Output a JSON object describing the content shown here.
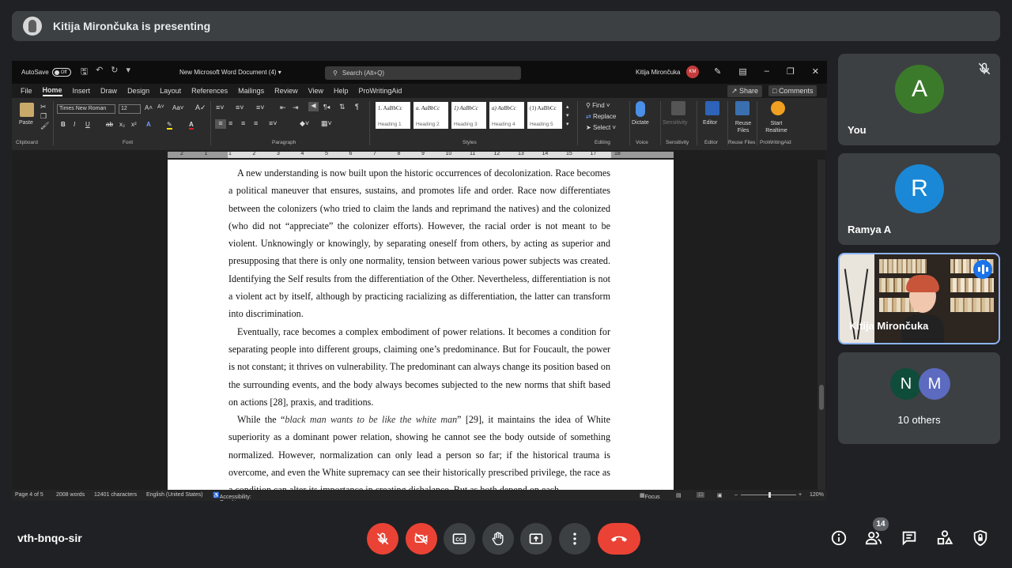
{
  "banner": {
    "text": "Kitija Mirončuka is presenting"
  },
  "word": {
    "autosave_label": "AutoSave",
    "autosave_state": "Off",
    "doc_title": "New Microsoft Word Document (4)",
    "search_placeholder": "Search (Alt+Q)",
    "user_name": "Kitija Mirončuka",
    "user_initials": "KM",
    "menu": [
      "File",
      "Home",
      "Insert",
      "Draw",
      "Design",
      "Layout",
      "References",
      "Mailings",
      "Review",
      "View",
      "Help",
      "ProWritingAid"
    ],
    "share_label": "Share",
    "comments_label": "Comments",
    "ribbon": {
      "paste": "Paste",
      "font_name": "Times New Roman",
      "font_size": "12",
      "styles": [
        {
          "preview": "1.  AaBbCc",
          "name": "Heading 1"
        },
        {
          "preview": "a.  AaBbCc",
          "name": "Heading 2"
        },
        {
          "preview": "1)  AaBbCc",
          "name": "Heading 3"
        },
        {
          "preview": "a)  AaBbCc",
          "name": "Heading 4"
        },
        {
          "preview": "(1)  AaBbCc",
          "name": "Heading 5"
        }
      ],
      "find": "Find",
      "replace": "Replace",
      "select": "Select",
      "dictate": "Dictate",
      "sensitivity": "Sensitivity",
      "editor": "Editor",
      "reuse_files": "Reuse Files",
      "start_realtime": "Start Realtime",
      "groups": [
        "Clipboard",
        "Font",
        "Paragraph",
        "Styles",
        "Editing",
        "Voice",
        "Sensitivity",
        "Editor",
        "Reuse Files",
        "ProWritingAid"
      ]
    },
    "ruler_numbers": [
      "2",
      "1",
      "1",
      "2",
      "3",
      "4",
      "5",
      "6",
      "7",
      "8",
      "9",
      "10",
      "11",
      "12",
      "13",
      "14",
      "15",
      "17",
      "18"
    ],
    "paragraphs": [
      "A new understanding is now built upon the historic occurrences of decolonization. Race becomes a political maneuver that ensures, sustains, and promotes life and order. Race now differentiates between the colonizers (who tried to claim the lands and reprimand the natives) and the colonized (who did not “appreciate” the colonizer efforts). However, the racial order is not meant to be violent. Unknowingly or knowingly, by separating oneself from others, by acting as superior and presupposing that there is only one normality, tension between various power subjects was created. Identifying the Self results from the differentiation of the Other. Nevertheless, differentiation is not a violent act by itself, although by practicing racializing as differentiation, the latter can transform into discrimination.",
      "Eventually, race becomes a complex embodiment of power relations. It becomes a condition for separating people into different groups, claiming one’s predominance. But for Foucault, the power is not constant; it thrives on vulnerability. The predominant can always change its position based on the surrounding events, and the body always becomes subjected to the new norms that shift based on actions [28], praxis, and traditions."
    ],
    "para3": {
      "before": "While the “",
      "italic": "black man wants to be like the white man",
      "after": "” [29], it maintains the idea of White superiority as a dominant power relation, showing he cannot see the body outside of something normalized. However, normalization can only lead a person so far; if the historical trauma is overcome, and even the White supremacy can see their historically prescribed privilege, the race as a condition can alter its importance in creating disbalance. But as both depend on each"
    },
    "status": {
      "page": "Page 4 of 5",
      "words": "2008 words",
      "chars": "12401 characters",
      "language": "English (United States)",
      "accessibility": "Accessibility: Good to go",
      "focus": "Focus",
      "zoom": "120%"
    }
  },
  "participants": [
    {
      "name": "You",
      "initial": "A",
      "color": "#3b7a2a"
    },
    {
      "name": "Ramya A",
      "initial": "R",
      "color": "#1a88d6"
    },
    {
      "name": "Kitija Mirončuka"
    }
  ],
  "others": {
    "label": "10 others",
    "avatars": [
      {
        "initial": "N",
        "color": "#0f4c3a"
      },
      {
        "initial": "M",
        "color": "#5c6bc0"
      }
    ]
  },
  "meeting": {
    "code": "vth-bnqo-sir",
    "people_count": "14"
  },
  "icons": [
    "mic-off-icon",
    "camera-off-icon",
    "captions-icon",
    "raise-hand-icon",
    "present-icon",
    "more-icon",
    "end-call-icon",
    "info-icon",
    "people-icon",
    "chat-icon",
    "activities-icon",
    "host-controls-icon"
  ]
}
